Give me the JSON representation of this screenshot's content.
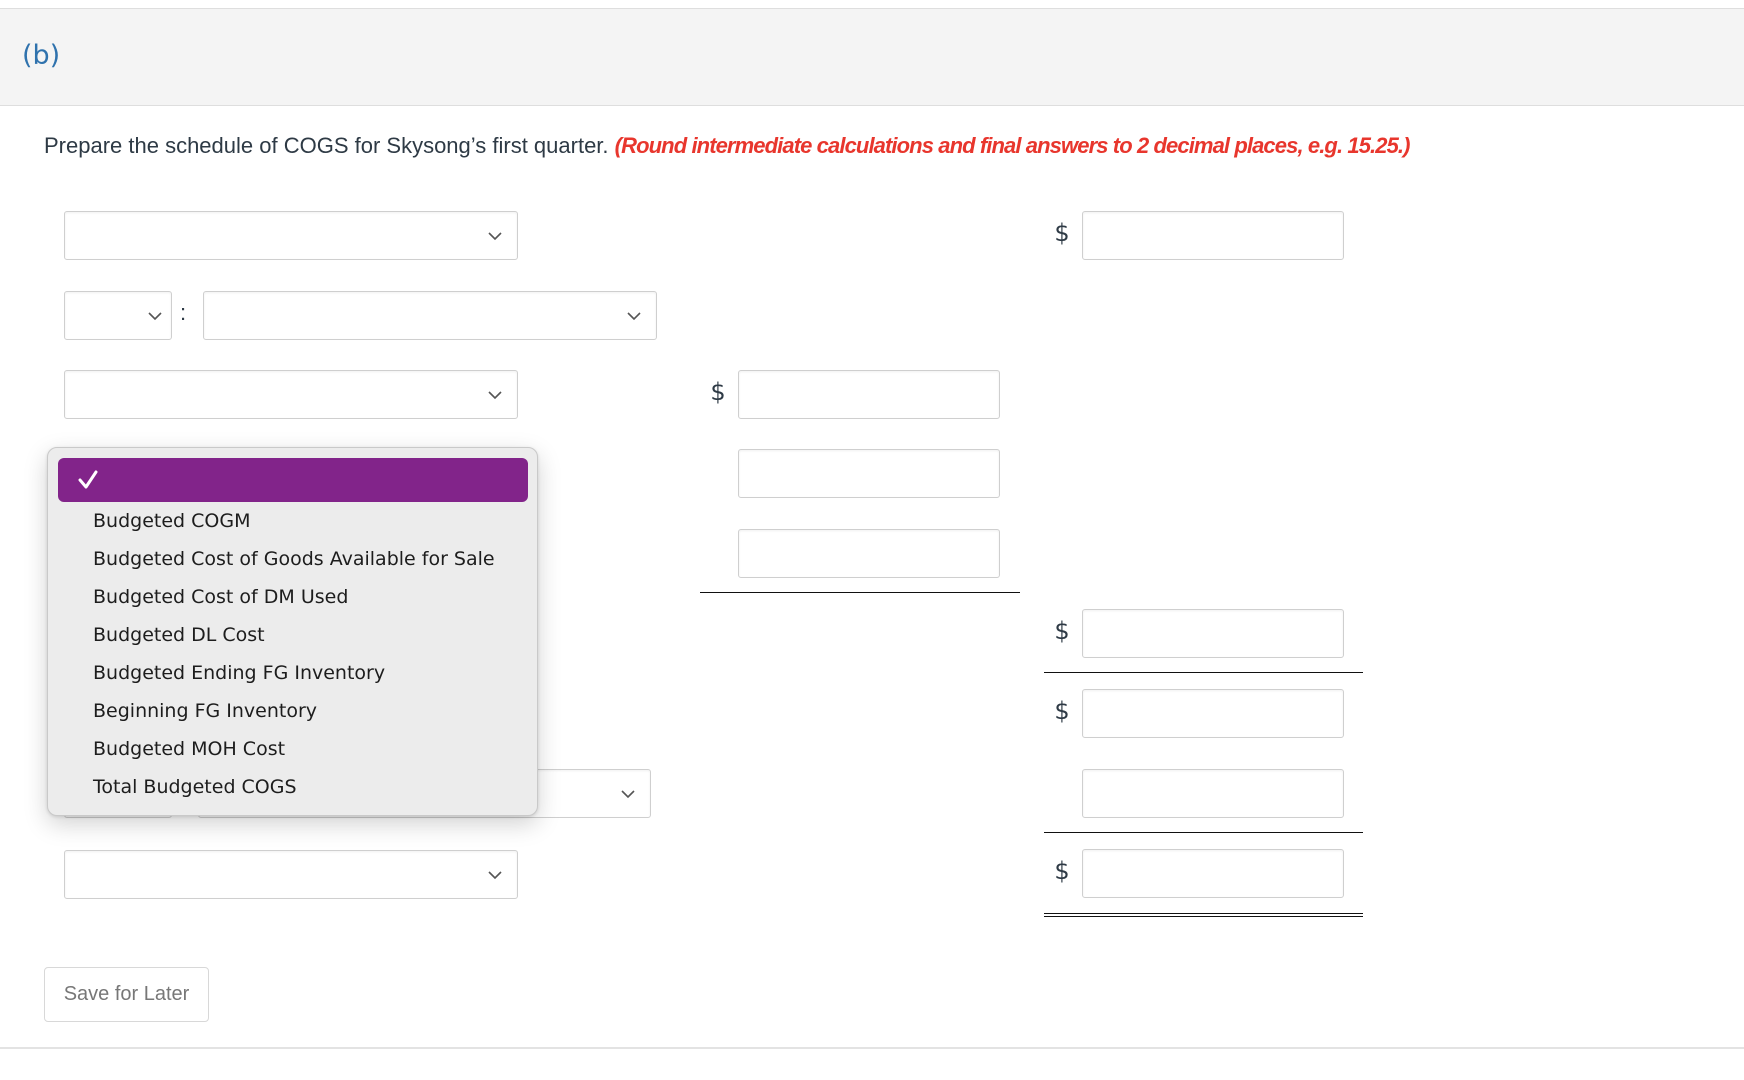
{
  "part_label": "(b)",
  "instructions": {
    "text": "Prepare the schedule of COGS for Skysong’s first quarter.",
    "note": "(Round intermediate calculations and final answers to 2 decimal places, e.g. 15.25.)"
  },
  "colors": {
    "part_label": "#2f72ad",
    "note": "#e8362d",
    "menu_highlight": "#82248a"
  },
  "currency_symbol": "$",
  "separator": ":",
  "form_rows": [
    {
      "row": 1,
      "label_select": "",
      "right_value": ""
    },
    {
      "row": 2,
      "prefix_select": "",
      "label_select": ""
    },
    {
      "row": 3,
      "label_select": "",
      "middle_value": ""
    },
    {
      "row": 4,
      "middle_value": ""
    },
    {
      "row": 5,
      "middle_value": ""
    },
    {
      "row": 6,
      "right_value": ""
    },
    {
      "row": 7,
      "right_value": ""
    },
    {
      "row": 8,
      "prefix_select": "",
      "label_select": "",
      "right_value": ""
    },
    {
      "row": 9,
      "label_select": "",
      "right_value": ""
    }
  ],
  "dropdown_menu": {
    "selected_option": "",
    "selected_icon": "check-icon",
    "options": [
      "Budgeted COGM",
      "Budgeted Cost of Goods Available for Sale",
      "Budgeted Cost of DM Used",
      "Budgeted DL Cost",
      "Budgeted Ending FG Inventory",
      "Beginning FG Inventory",
      "Budgeted MOH Cost",
      "Total Budgeted COGS"
    ]
  },
  "buttons": {
    "save_for_later": "Save for Later"
  }
}
